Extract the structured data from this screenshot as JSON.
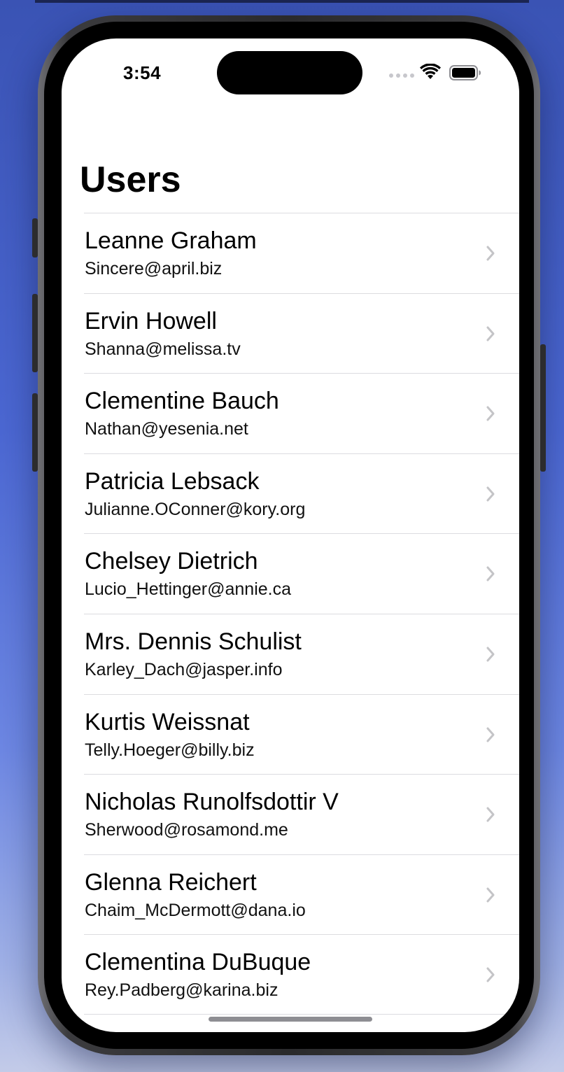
{
  "status_bar": {
    "time": "3:54"
  },
  "header": {
    "title": "Users"
  },
  "users": [
    {
      "name": "Leanne Graham",
      "email": "Sincere@april.biz"
    },
    {
      "name": "Ervin Howell",
      "email": "Shanna@melissa.tv"
    },
    {
      "name": "Clementine Bauch",
      "email": "Nathan@yesenia.net"
    },
    {
      "name": "Patricia Lebsack",
      "email": "Julianne.OConner@kory.org"
    },
    {
      "name": "Chelsey Dietrich",
      "email": "Lucio_Hettinger@annie.ca"
    },
    {
      "name": "Mrs. Dennis Schulist",
      "email": "Karley_Dach@jasper.info"
    },
    {
      "name": "Kurtis Weissnat",
      "email": "Telly.Hoeger@billy.biz"
    },
    {
      "name": "Nicholas Runolfsdottir V",
      "email": "Sherwood@rosamond.me"
    },
    {
      "name": "Glenna Reichert",
      "email": "Chaim_McDermott@dana.io"
    },
    {
      "name": "Clementina DuBuque",
      "email": "Rey.Padberg@karina.biz"
    }
  ],
  "icons": {
    "row_accessory": "chevron-right-icon",
    "wifi": "wifi-icon",
    "battery": "battery-icon",
    "signal": "cellular-signal-icon"
  },
  "colors": {
    "background_top": "#3a53b4",
    "background_bottom": "#c3cbe8",
    "separator": "#dcdce0",
    "chevron": "#c4c4c7"
  }
}
